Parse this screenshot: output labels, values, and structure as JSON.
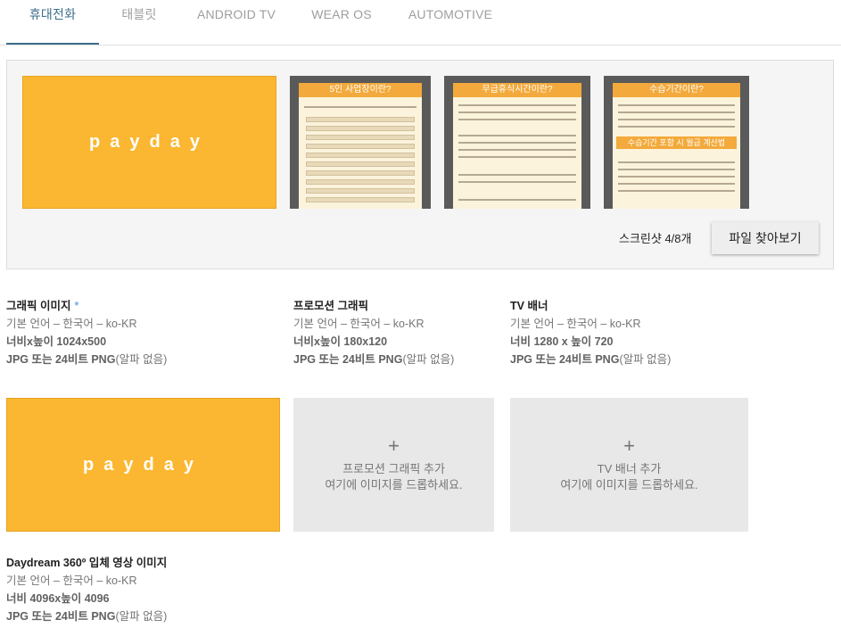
{
  "tabs": [
    {
      "label": "휴대전화",
      "active": true
    },
    {
      "label": "태블릿",
      "active": false
    },
    {
      "label": "ANDROID TV",
      "active": false
    },
    {
      "label": "WEAR OS",
      "active": false
    },
    {
      "label": "AUTOMOTIVE",
      "active": false
    }
  ],
  "panel": {
    "feature_brand": "payday",
    "screenshots": [
      {
        "heading": "5인 사업장이란?"
      },
      {
        "heading": "무급휴식시간이란?"
      },
      {
        "heading": "수습기간이란?",
        "subheading": "수습기간 포함 시 월급 계산법"
      }
    ],
    "count_text": "스크린샷 4/8개",
    "browse_label": "파일 찾아보기"
  },
  "assets": [
    {
      "title": "그래픽 이미지",
      "required_mark": "*",
      "language": "기본 언어 – 한국어 – ko-KR",
      "size": "너비x높이 1024x500",
      "format_bold": "JPG 또는 24비트 PNG",
      "format_rest": "(알파 없음)"
    },
    {
      "title": "프로모션 그래픽",
      "language": "기본 언어 – 한국어 – ko-KR",
      "size": "너비x높이 180x120",
      "format_bold": "JPG 또는 24비트 PNG",
      "format_rest": "(알파 없음)"
    },
    {
      "title": "TV 배너",
      "language": "기본 언어 – 한국어 – ko-KR",
      "size": "너비 1280 x 높이 720",
      "format_bold": "JPG 또는 24비트 PNG",
      "format_rest": "(알파 없음)"
    },
    {
      "title": "Daydream 360º 입체 영상 이미지",
      "language": "기본 언어 – 한국어 – ko-KR",
      "size": "너비 4096x높이 4096",
      "format_bold": "JPG 또는 24비트 PNG",
      "format_rest": "(알파 없음)"
    }
  ],
  "tiles": {
    "feature_brand": "payday",
    "plus": "+",
    "promo_add": "프로모션 그래픽 추가",
    "tv_add": "TV 배너 추가",
    "drop_hint": "여기에 이미지를 드롭하세요."
  },
  "colors": {
    "accent": "#3d6e8a",
    "brand_orange": "#fbb731",
    "required_star": "#4285f4"
  }
}
